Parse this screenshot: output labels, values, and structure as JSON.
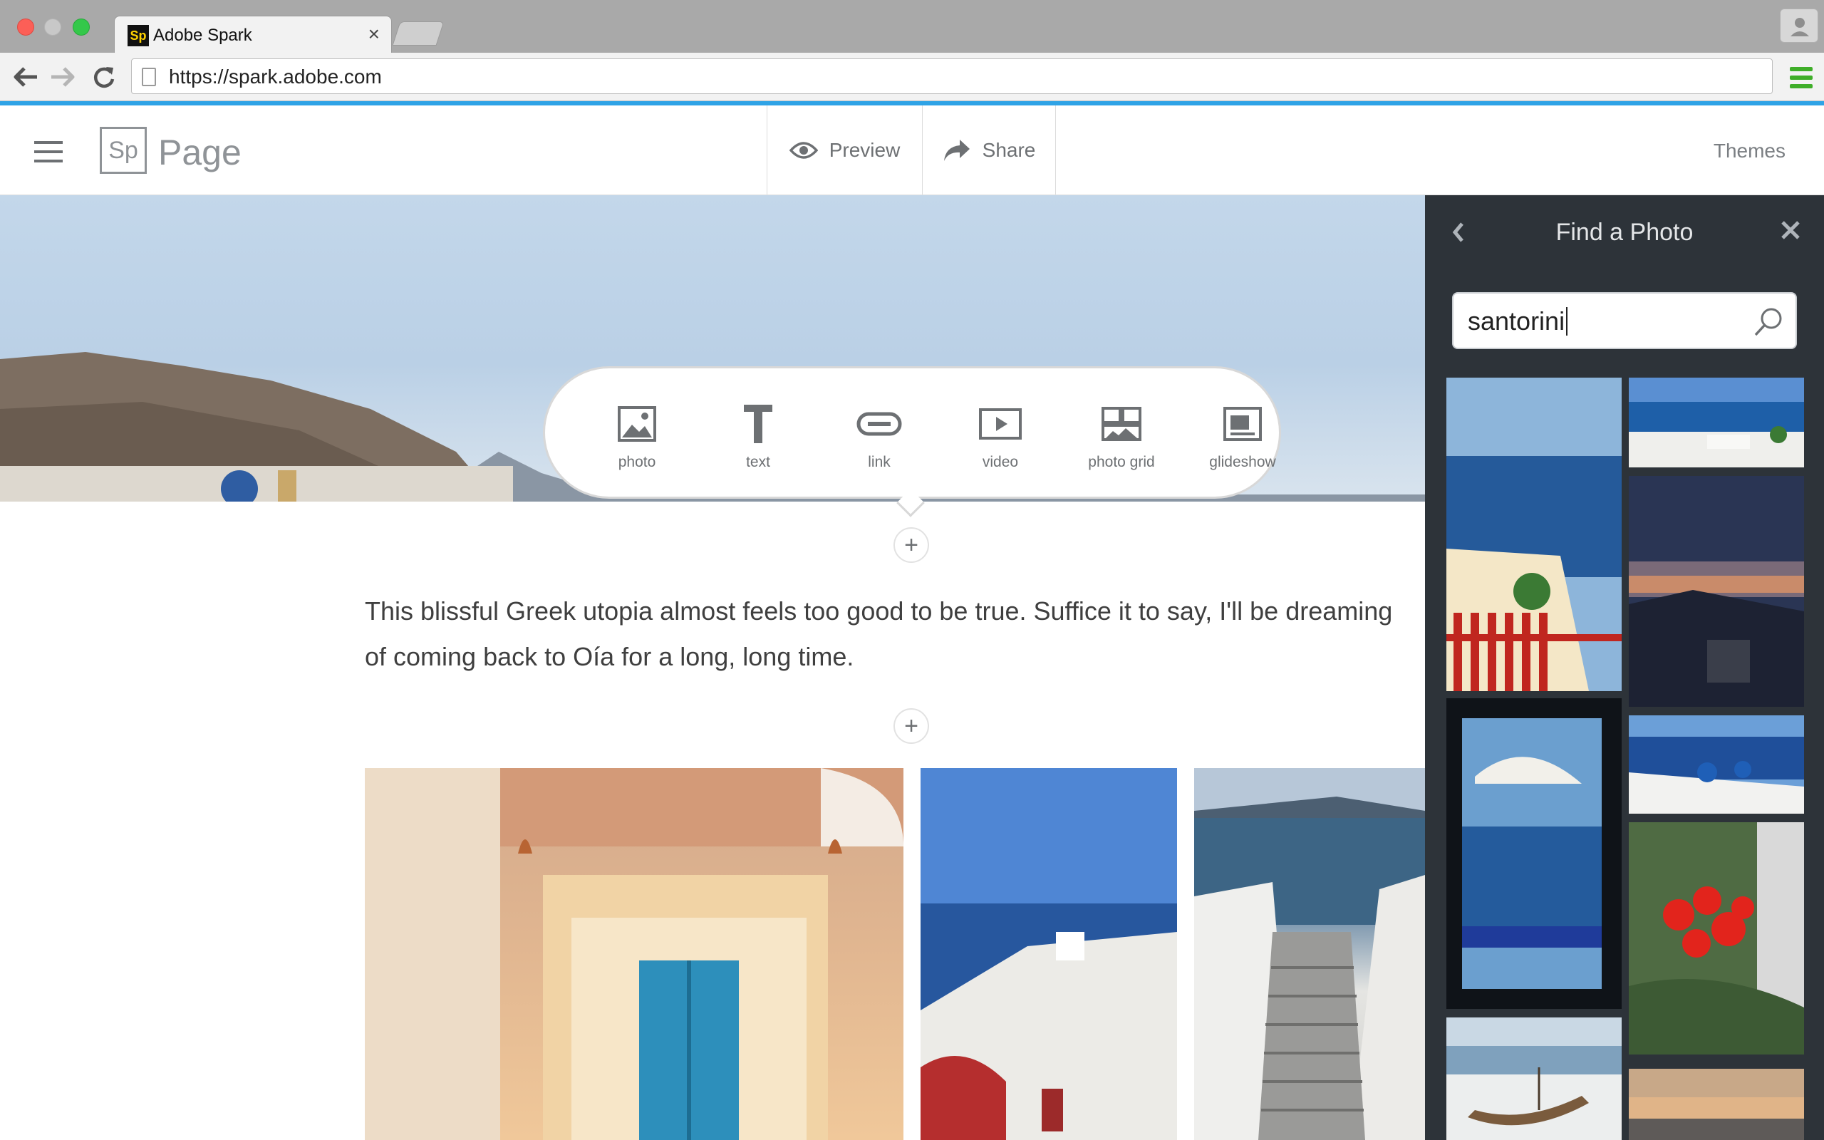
{
  "browser": {
    "tab_title": "Adobe Spark",
    "tab_favicon": "Sp",
    "url": "https://spark.adobe.com"
  },
  "header": {
    "logo": "Sp",
    "product": "Page",
    "preview_label": "Preview",
    "share_label": "Share",
    "themes_label": "Themes"
  },
  "insert_menu": {
    "items": [
      {
        "label": "photo",
        "icon": "photo-icon"
      },
      {
        "label": "text",
        "icon": "text-icon"
      },
      {
        "label": "link",
        "icon": "link-icon"
      },
      {
        "label": "video",
        "icon": "video-icon"
      },
      {
        "label": "photo grid",
        "icon": "photo-grid-icon"
      },
      {
        "label": "glideshow",
        "icon": "glideshow-icon"
      }
    ]
  },
  "content": {
    "paragraph_line1": "This blissful Greek utopia almost feels too good to be true. Suffice it to say, I'll be dreaming",
    "paragraph_line2": "of coming back to Oía for a long, long time."
  },
  "photo_panel": {
    "title": "Find a Photo",
    "search_value": "santorini"
  },
  "colors": {
    "accent_blue": "#2fa3e6",
    "panel_bg": "#2d3339",
    "text_gray": "#6d7073",
    "mac_close": "#fc5f57",
    "mac_zoom": "#34c84a",
    "menu_green": "#3fae29"
  }
}
